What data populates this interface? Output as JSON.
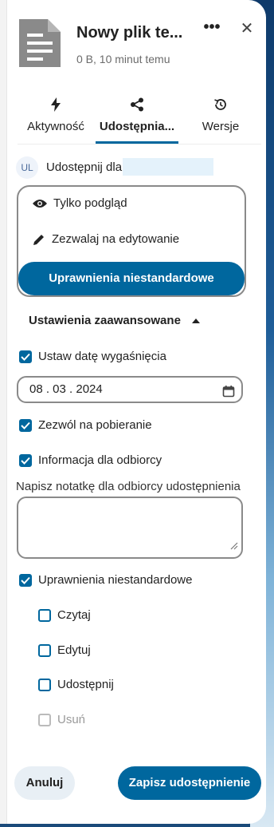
{
  "header": {
    "title": "Nowy plik te...",
    "subtitle": "0 B, 10 minut temu",
    "more_label": "•••",
    "close_label": "✕"
  },
  "tabs": [
    {
      "label": "Aktywność",
      "icon": "lightning-icon",
      "active": false
    },
    {
      "label": "Udostępnia...",
      "icon": "share-icon",
      "active": true
    },
    {
      "label": "Wersje",
      "icon": "history-icon",
      "active": false
    }
  ],
  "share": {
    "avatar_initials": "UL",
    "label": "Udostępnij dla"
  },
  "permissions": {
    "view_only": "Tylko podgląd",
    "allow_edit": "Zezwalaj na edytowanie",
    "custom": "Uprawnienia niestandardowe"
  },
  "advanced": {
    "toggle_label": "Ustawienia zaawansowane",
    "expiration_label": "Ustaw datę wygaśnięcia",
    "expiration_date": "08 . 03 . 2024",
    "allow_download_label": "Zezwól na pobieranie",
    "recipient_info_label": "Informacja dla odbiorcy",
    "note_label": "Napisz notatkę dla odbiorcy udostępnienia",
    "custom_permissions_label": "Uprawnienia niestandardowe",
    "perm_read": "Czytaj",
    "perm_edit": "Edytuj",
    "perm_share": "Udostępnij",
    "perm_delete": "Usuń"
  },
  "footer": {
    "cancel": "Anuluj",
    "save": "Zapisz udostępnienie"
  },
  "colors": {
    "accent": "#00679e"
  }
}
